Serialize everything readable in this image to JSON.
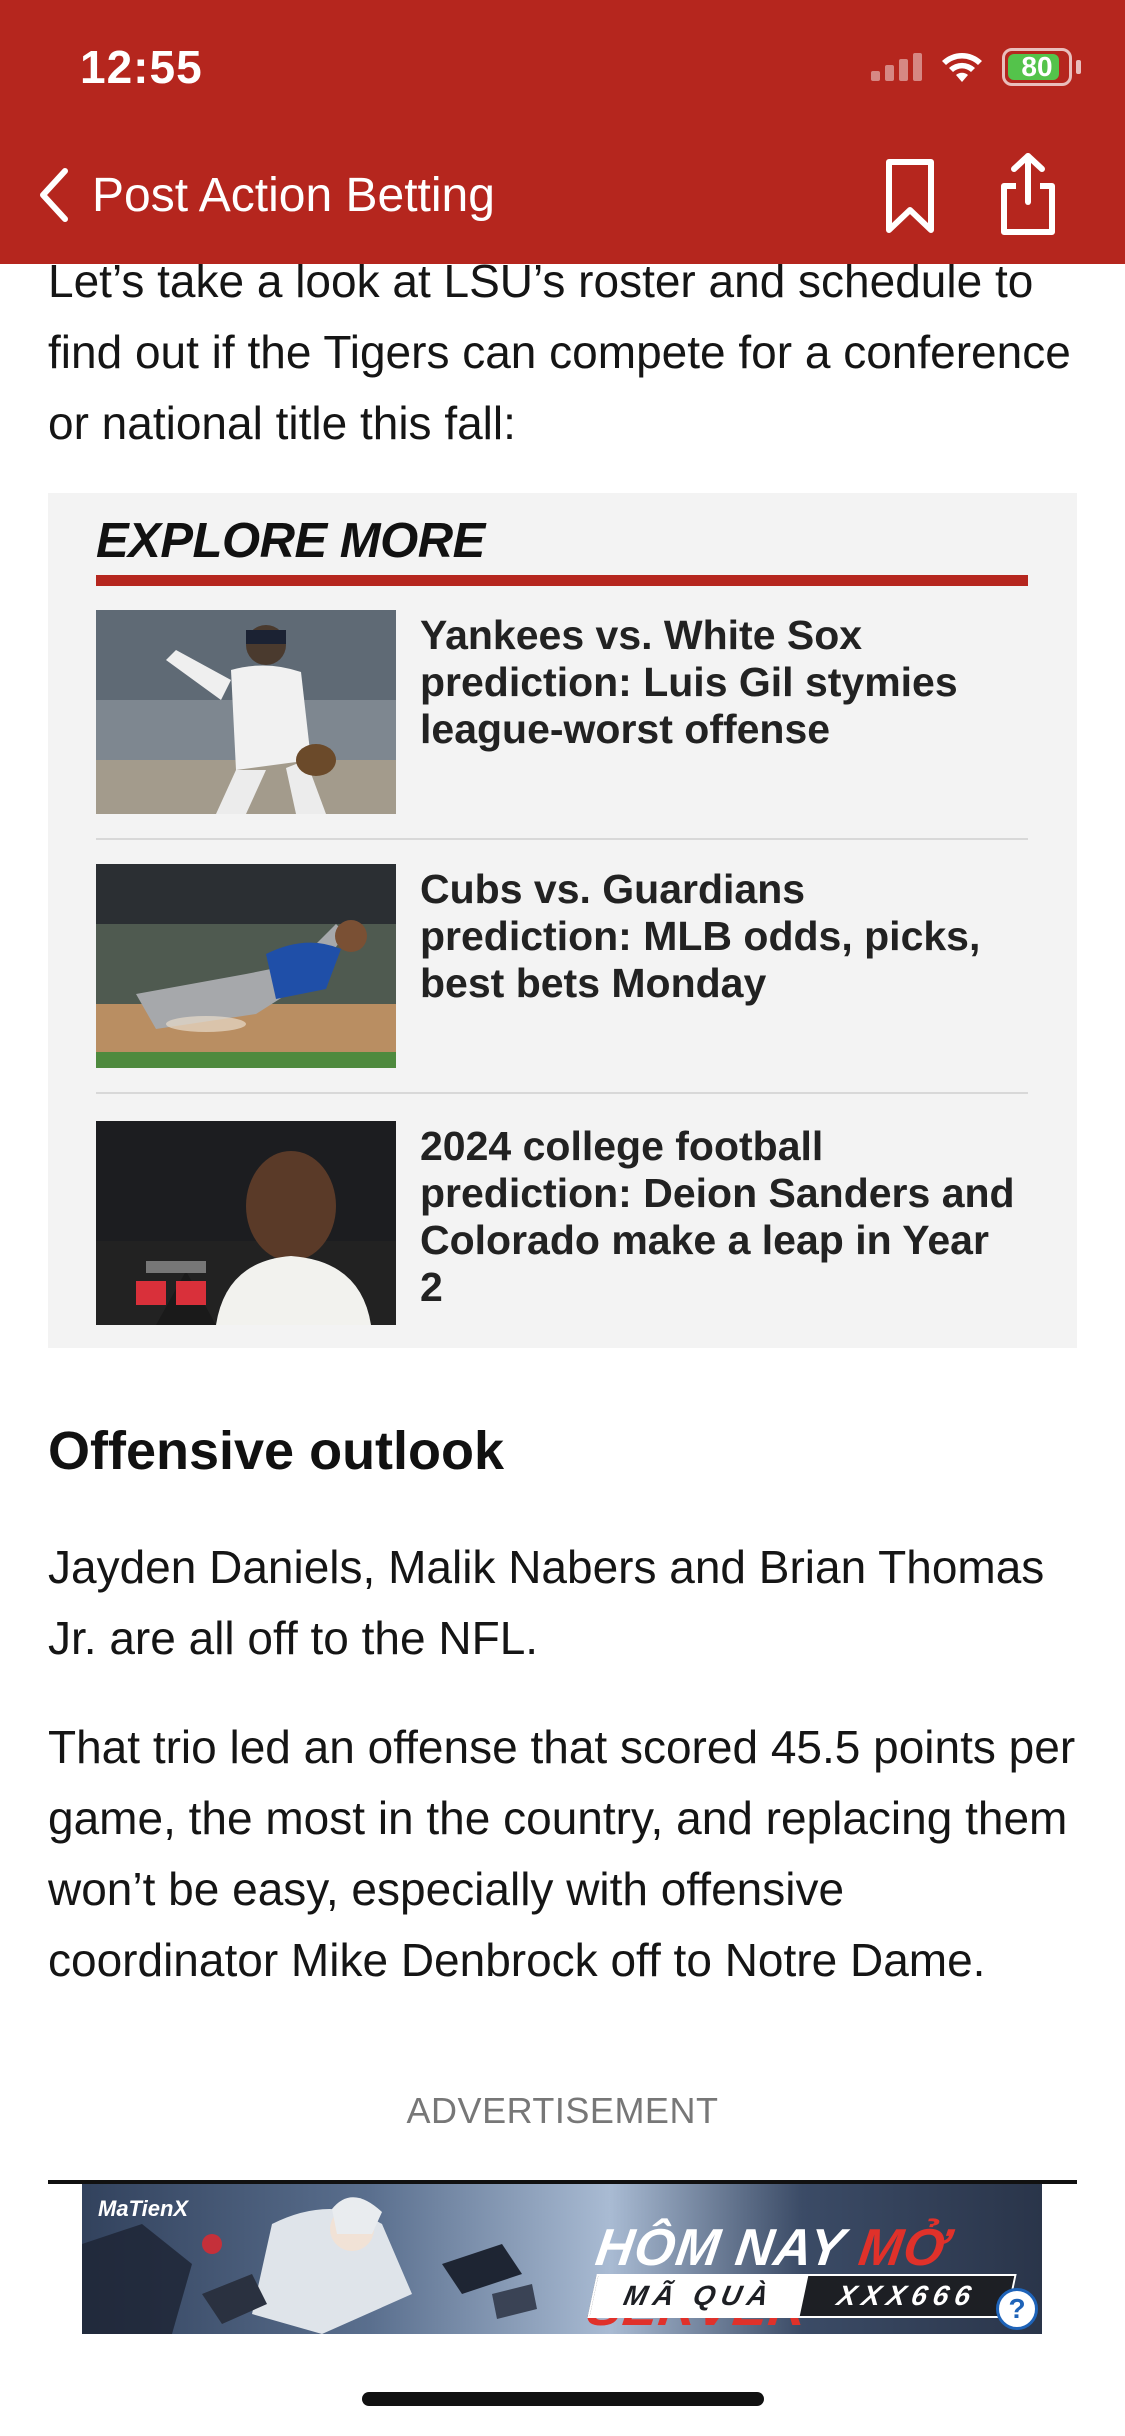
{
  "status_bar": {
    "time": "12:55",
    "battery_percent": "80",
    "battery_level": 0.8
  },
  "nav": {
    "title": "Post Action Betting",
    "icons": [
      "chevron-left-icon",
      "bookmark-icon",
      "share-icon"
    ]
  },
  "article": {
    "intro": "Let’s take a look at LSU’s roster and schedule to find out if the Tigers can compete for a conference or national title this fall:",
    "section_heading": "Offensive outlook",
    "paragraphs": [
      "Jayden Daniels, Malik Nabers and Brian Thomas Jr. are all off to the NFL.",
      "That trio led an offense that scored 45.5 points per game, the most in the country, and replacing them won’t be easy, especially with offensive coordinator Mike Denbrock off to Notre Dame."
    ]
  },
  "explore_more": {
    "title": "EXPLORE MORE",
    "items": [
      {
        "headline": "Yankees vs. White Sox prediction: Luis Gil stymies league-worst offense"
      },
      {
        "headline": "Cubs vs. Guardians prediction: MLB odds, picks, best bets Monday"
      },
      {
        "headline": "2024 college football prediction: Deion Sanders and Colorado make a leap in Year 2"
      }
    ]
  },
  "advertisement": {
    "label": "ADVERTISEMENT",
    "logo_text": "MaTienX",
    "headline_part1": "HÔM NAY ",
    "headline_part2": "MỞ SERVER",
    "code_label": "MÃ QUÀ",
    "code_value": "XXX666",
    "info_symbol": "?"
  },
  "colors": {
    "brand_red": "#b5261e",
    "explore_bg": "#f3f3f3"
  }
}
